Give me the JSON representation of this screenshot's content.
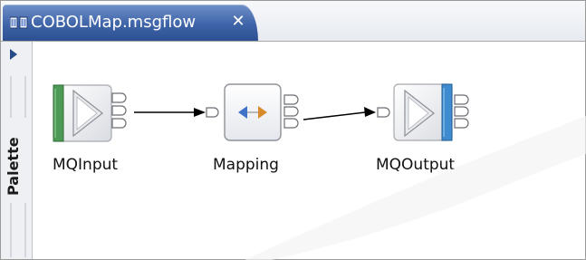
{
  "editor": {
    "tab_title": "COBOLMap.msgflow",
    "close_symbol": "✕",
    "tab_icon": "message-flow-icon"
  },
  "palette": {
    "label": "Palette",
    "toggle_icon": "expand-arrow-icon"
  },
  "flow": {
    "nodes": [
      {
        "label": "MQInput",
        "icon": "mq-input-node-icon"
      },
      {
        "label": "Mapping",
        "icon": "mapping-node-icon"
      },
      {
        "label": "MQOutput",
        "icon": "mq-output-node-icon"
      }
    ]
  },
  "colors": {
    "tab_blue": "#3f64a8",
    "input_bar_green": "#4c9a55",
    "output_bar_blue": "#3e8bd0",
    "mapping_arrow_blue": "#3f72c8",
    "mapping_arrow_orange": "#d88b2a"
  }
}
